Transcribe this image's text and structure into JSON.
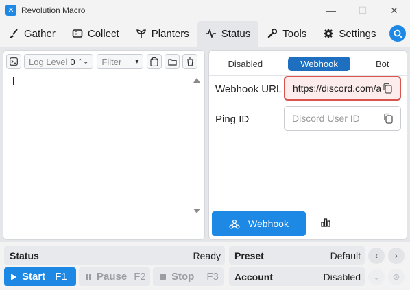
{
  "window": {
    "title": "Revolution Macro",
    "controls": {
      "minimize": "—",
      "maximize": "☐",
      "close": "✕"
    }
  },
  "tabs": [
    {
      "label": "Gather",
      "icon": "broom-icon"
    },
    {
      "label": "Collect",
      "icon": "ticket-icon"
    },
    {
      "label": "Planters",
      "icon": "sprout-icon"
    },
    {
      "label": "Status",
      "icon": "pulse-icon",
      "active": true
    },
    {
      "label": "Tools",
      "icon": "wrench-icon"
    },
    {
      "label": "Settings",
      "icon": "gear-icon"
    }
  ],
  "log": {
    "log_level_label": "Log Level",
    "log_level_value": "0",
    "filter_label": "Filter"
  },
  "status_panel": {
    "segments": [
      "Disabled",
      "Webhook",
      "Bot"
    ],
    "active_segment": "Webhook",
    "webhook_url_label": "Webhook URL",
    "webhook_url_value": "https://discord.com/api",
    "ping_id_label": "Ping ID",
    "ping_id_placeholder": "Discord User ID",
    "webhook_button_label": "Webhook"
  },
  "bottom": {
    "status_label": "Status",
    "status_value": "Ready",
    "start_label": "Start",
    "start_key": "F1",
    "pause_label": "Pause",
    "pause_key": "F2",
    "stop_label": "Stop",
    "stop_key": "F3",
    "preset_label": "Preset",
    "preset_value": "Default",
    "account_label": "Account",
    "account_value": "Disabled"
  },
  "colors": {
    "accent": "#1e88e5",
    "segment_active": "#1e6fbf",
    "error_border": "#d9534f"
  }
}
